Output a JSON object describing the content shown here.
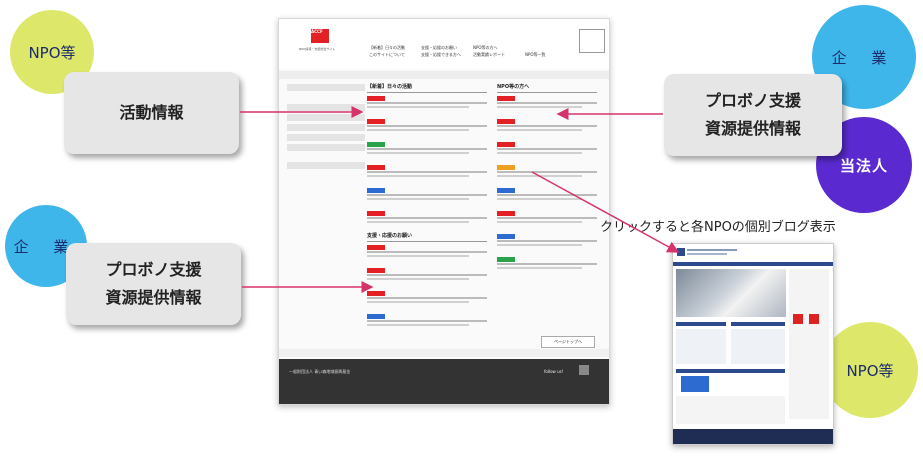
{
  "labels": {
    "left_top": "活動情報",
    "left_bottom": [
      "プロボノ支援",
      "資源提供情報"
    ],
    "right_top": [
      "プロボノ支援",
      "資源提供情報"
    ]
  },
  "circles": {
    "npo_top_left": "NPO等",
    "corp_left": "企 業",
    "corp_right": "企 業",
    "houjin": "当法人",
    "npo_bottom_right": "NPO等"
  },
  "caption": "クリックすると各NPOの個別ブログ表示",
  "site": {
    "logo": "ACCF",
    "logo_caption": "NPO情報・支援総合サイト",
    "nav": [
      "【新着】日々の活動",
      "支援・応援のお願い",
      "NPO等の方へ",
      "このサイトについて",
      "支援・応援できる方へ",
      "活動実績レポート",
      "NPO等一覧"
    ],
    "col1_title": "【新着】日々の活動",
    "col2_title": "NPO等の方へ",
    "col3_title": "支援・応援のお願い",
    "page_top": "ページトップへ",
    "follow": "follow us!",
    "footer_org": "一般財団法人 青い森地域振興基金"
  },
  "colors": {
    "npo_circle": "#dde86a",
    "corp_circle": "#3fb6ea",
    "houjin_circle": "#5a2ad0",
    "arrow": "#d6336c",
    "logo_red": "#e32024"
  }
}
